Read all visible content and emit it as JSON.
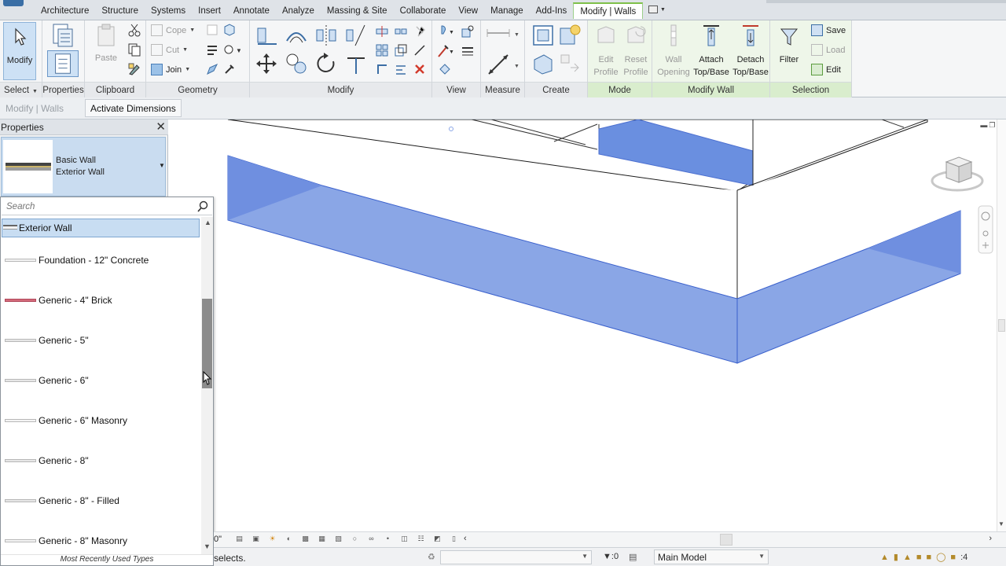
{
  "tabs": [
    "Architecture",
    "Structure",
    "Systems",
    "Insert",
    "Annotate",
    "Analyze",
    "Massing & Site",
    "Collaborate",
    "View",
    "Manage",
    "Add-Ins",
    "Modify | Walls"
  ],
  "ribbon": {
    "select": {
      "modify": "Modify",
      "label": "Select"
    },
    "properties": {
      "label": "Properties"
    },
    "clipboard": {
      "paste": "Paste",
      "label": "Clipboard"
    },
    "geometry": {
      "cope": "Cope",
      "cut": "Cut",
      "join": "Join",
      "label": "Geometry"
    },
    "modify": {
      "label": "Modify"
    },
    "view": {
      "label": "View"
    },
    "measure": {
      "label": "Measure"
    },
    "create": {
      "label": "Create"
    },
    "mode": {
      "edit_profile": [
        "Edit",
        "Profile"
      ],
      "reset_profile": [
        "Reset",
        "Profile"
      ],
      "label": "Mode"
    },
    "modify_wall": {
      "wall_opening": [
        "Wall",
        "Opening"
      ],
      "attach": [
        "Attach",
        "Top/Base"
      ],
      "detach": [
        "Detach",
        "Top/Base"
      ],
      "label": "Modify Wall"
    },
    "selection": {
      "filter": "Filter",
      "save": "Save",
      "load": "Load",
      "edit": "Edit",
      "label": "Selection"
    }
  },
  "options_bar": {
    "context": "Modify | Walls",
    "activate_dimensions": "Activate Dimensions"
  },
  "properties": {
    "title": "Properties",
    "type_family": "Basic Wall",
    "type_name": "Exterior Wall"
  },
  "type_dropdown": {
    "search_placeholder": "Search",
    "selected": "Exterior Wall",
    "items": [
      {
        "label": "Foundation - 12\" Concrete",
        "swatch": "#f2f2f2"
      },
      {
        "label": "Generic - 4\" Brick",
        "swatch": "#d36a7a"
      },
      {
        "label": "Generic - 5\"",
        "swatch": "#e6e6e6"
      },
      {
        "label": "Generic - 6\"",
        "swatch": "#e6e6e6"
      },
      {
        "label": "Generic - 6\" Masonry",
        "swatch": "#f4f4f4"
      },
      {
        "label": "Generic - 8\"",
        "swatch": "#e6e6e6"
      },
      {
        "label": "Generic - 8\" - Filled",
        "swatch": "#e6e6e6"
      },
      {
        "label": "Generic - 8\" Masonry",
        "swatch": "#f4f4f4"
      }
    ],
    "footer": "Most Recently Used Types"
  },
  "view_bar": {
    "scale": "0\""
  },
  "status_bar": {
    "message": "selects.",
    "filter_count": ":0",
    "model": "Main Model",
    "select_count": ":4"
  },
  "colors": {
    "accent_green": "#7fc04a",
    "selection_blue": "#6a8fe0",
    "ribbon_bg": "#f5f6f7"
  }
}
